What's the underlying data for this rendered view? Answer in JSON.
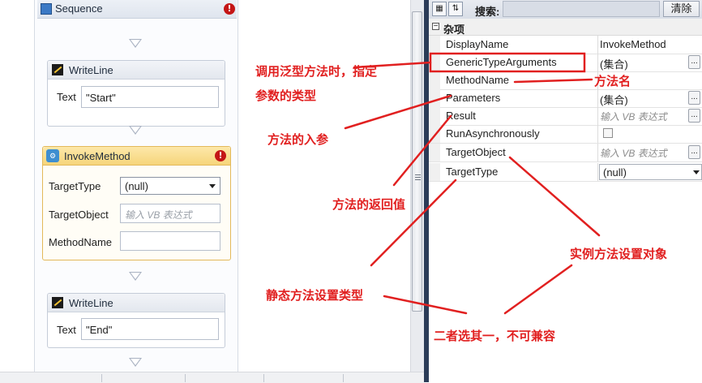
{
  "sequence": {
    "title": "Sequence",
    "error_mark": "!"
  },
  "writeline1": {
    "title": "WriteLine",
    "text_label": "Text",
    "text_value": "\"Start\""
  },
  "invoke": {
    "title": "InvokeMethod",
    "error_mark": "!",
    "target_type_label": "TargetType",
    "target_type_value": "(null)",
    "target_object_label": "TargetObject",
    "target_object_placeholder": "输入 VB 表达式",
    "method_name_label": "MethodName",
    "method_name_value": ""
  },
  "writeline2": {
    "title": "WriteLine",
    "text_label": "Text",
    "text_value": "\"End\""
  },
  "props": {
    "search_label": "搜索:",
    "clear_label": "清除",
    "category": "杂项",
    "category_toggle": "⊟",
    "ellipsis": "...",
    "rows": [
      {
        "name": "DisplayName",
        "value": "InvokeMethod"
      },
      {
        "name": "GenericTypeArguments",
        "value": "(集合)"
      },
      {
        "name": "MethodName",
        "value": ""
      },
      {
        "name": "Parameters",
        "value": "(集合)"
      },
      {
        "name": "Result",
        "value": "输入 VB 表达式"
      },
      {
        "name": "RunAsynchronously",
        "value": ""
      },
      {
        "name": "TargetObject",
        "value": "输入 VB 表达式"
      },
      {
        "name": "TargetType",
        "value": "(null)"
      }
    ]
  },
  "annotations": {
    "generic_line1": "调用泛型方法时，指定",
    "generic_line2": "参数的类型",
    "method_name": "方法名",
    "parameters": "方法的入参",
    "result": "方法的返回值",
    "static_type": "静态方法设置类型",
    "instance_object": "实例方法设置对象",
    "choose_one": "二者选其一，不可兼容"
  },
  "colors": {
    "annotation": "#e12020",
    "splitter": "#2b3c58",
    "invoke_header": "#f6d57b"
  }
}
